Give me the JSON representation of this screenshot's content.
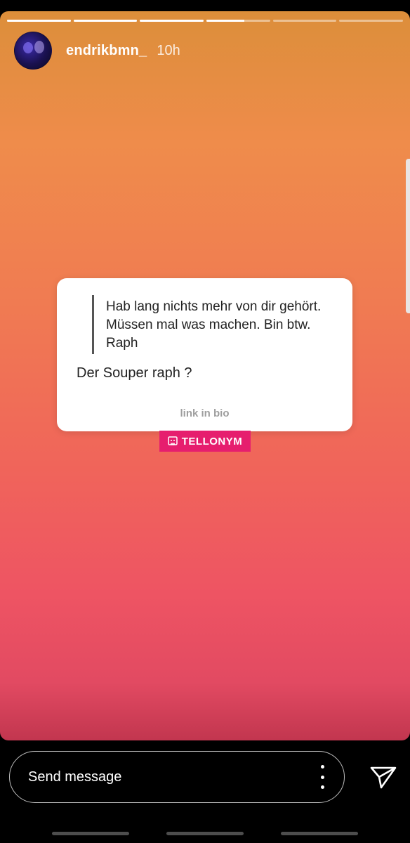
{
  "story": {
    "progress_segments": [
      1,
      1,
      1,
      0.6,
      0,
      0
    ],
    "username": "endrikbmn_",
    "time": "10h"
  },
  "card": {
    "quote": "Hab lang nichts mehr von dir gehört. Müssen mal was machen. Bin btw. Raph",
    "reply": "Der Souper raph ?",
    "link": "link in bio"
  },
  "badge": {
    "label": "TELLONYM",
    "color": "#e61e6e"
  },
  "footer": {
    "placeholder": "Send message",
    "icons": [
      "more-icon",
      "send-icon"
    ]
  }
}
